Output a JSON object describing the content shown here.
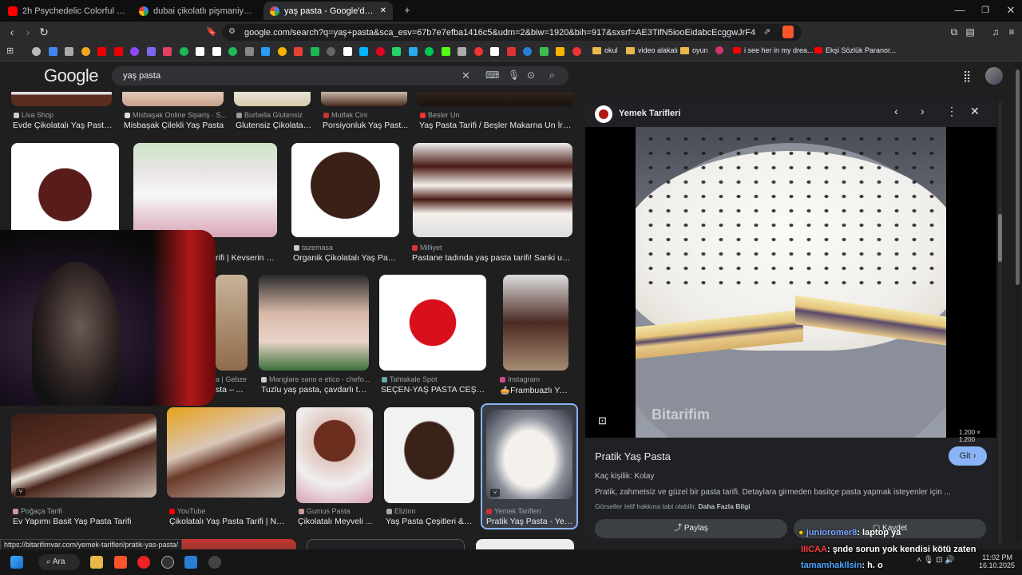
{
  "tabs": [
    {
      "label": "2h Psychedelic Colorful Neon Backgro",
      "icon": "youtube-icon"
    },
    {
      "label": "dubai çikolatlı pişmaniye - Google'da",
      "icon": "google-icon"
    },
    {
      "label": "yaş pasta - Google'da Ara",
      "icon": "google-icon"
    }
  ],
  "window_controls": {
    "minimize": "—",
    "maximize": "❐",
    "close": "✕",
    "new_tab": "+"
  },
  "address_bar": {
    "url": "google.com/search?q=yaş+pasta&sca_esv=67b7e7efba1416c5&udm=2&biw=1920&bih=917&sxsrf=AE3TifN5iooEidabcEcggwJrF4wkTE0s7A%3A1760644..."
  },
  "bookmarks": [
    {
      "label": "okul",
      "type": "folder"
    },
    {
      "label": "video alakalı",
      "type": "folder"
    },
    {
      "label": "oyun",
      "type": "folder"
    },
    {
      "label": "i see her in my drea...",
      "type": "youtube"
    },
    {
      "label": "Ekşi Sözlük Paranor...",
      "type": "youtube"
    }
  ],
  "google": {
    "logo": "Google",
    "query": "yaş pasta"
  },
  "top_row": [
    {
      "source": "Liva Shop",
      "title": "Evde Çikolatalı Yaş Pasta..."
    },
    {
      "source": "Misbaşak Online Sipariş · S...",
      "title": "Misbaşak Çilekli Yaş Pasta"
    },
    {
      "source": "Burbella Glutensiz",
      "title": "Glutensiz Çikolata-..."
    },
    {
      "source": "Mutfak Cini",
      "title": "Porsiyonluk Yaş Past..."
    },
    {
      "source": "Besler Un",
      "title": "Yaş Pasta Tarifi / Beşler Makarna Un İrmik..."
    }
  ],
  "row2": [
    {
      "source": "",
      "title": ""
    },
    {
      "source": "",
      "title": "rifi | Kevserin M..."
    },
    {
      "source": "tazemasa",
      "title": "Organik Çikolatalı Yaş Past..."
    },
    {
      "source": "Milliyet",
      "title": "Pastane tadında yaş pasta tarifi! Sanki usta ..."
    }
  ],
  "row3": [
    {
      "source": "a | Gebze",
      "title": "sta – ..."
    },
    {
      "source": "Mangiare sano e etico - chefo...",
      "title": "Tuzlu yaş pasta, çavdarlı tos..."
    },
    {
      "source": "Tahtakale Spot",
      "title": "SEÇEN-YAŞ PASTA CEŞİT..."
    },
    {
      "source": "Instagram",
      "title": "🥧Frambuazlı Yaş..."
    }
  ],
  "row4": [
    {
      "source": "Poğaça Tarifi",
      "title": "Ev Yapımı Basit Yaş Pasta Tarifi"
    },
    {
      "source": "YouTube",
      "title": "Çikolatalı Yaş Pasta Tarifi | Na..."
    },
    {
      "source": "Gumus Pasta",
      "title": "Çikolatalı Meyveli ..."
    },
    {
      "source": "Elizinn",
      "title": "Yaş Pasta Çeşitleri & Y..."
    },
    {
      "source": "Yemek Tarifleri",
      "title": "Pratik Yaş Pasta - Yem..."
    }
  ],
  "panel": {
    "site": "Yemek Tarifleri",
    "image_size": "1.200 × 1.200",
    "watermark": "Bitarifim",
    "title": "Pratik Yaş Pasta",
    "visit": "Git",
    "servings": "Kaç kişilik: Kolay",
    "description": "Pratik, zahmetsiz ve güzel bir pasta tarifi. Detaylara girmeden basitçe pasta yapmak isteyenler için ...",
    "copyright": "Görseller telif hakkına tabi olabilir.",
    "more_info": "Daha Fazla Bilgi",
    "share": "Paylaş",
    "save": "Kaydet"
  },
  "status_url": "https://bitarifimvar.com/yemek-tarifleri/pratik-yas-pasta/",
  "chat": [
    {
      "user": "junioromer8",
      "msg": ": laptop ya"
    },
    {
      "user": "IIICAA",
      "msg": ": şnde sorun yok kendisi kötü zaten"
    },
    {
      "user": "tamamhakllsin",
      "msg": ": h. o"
    }
  ],
  "taskbar": {
    "search": "Ara",
    "time": "11:02 PM",
    "date": "16.10.2025"
  }
}
